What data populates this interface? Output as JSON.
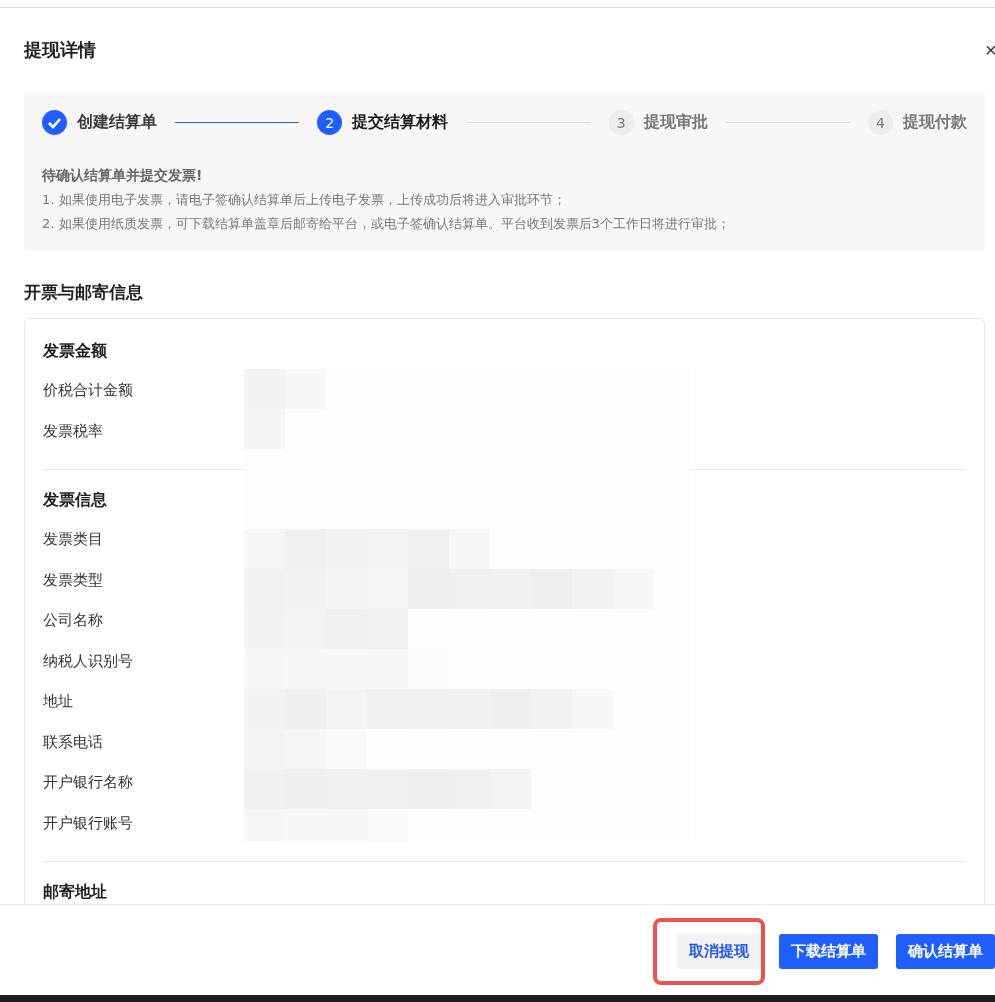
{
  "dialog": {
    "title": "提现详情",
    "close": "×"
  },
  "steps": [
    {
      "label": "创建结算单",
      "completed": true,
      "selected": false
    },
    {
      "index": "2",
      "label": "提交结算材料",
      "completed": false,
      "selected": true
    },
    {
      "index": "3",
      "label": "提现审批",
      "completed": false,
      "selected": false
    },
    {
      "index": "4",
      "label": "提现付款",
      "completed": false,
      "selected": false
    }
  ],
  "notice": {
    "heading": "待确认结算单并提交发票!",
    "lines": [
      "1. 如果使用电子发票，请电子签确认结算单后上传电子发票，上传成功后将进入审批环节；",
      "2. 如果使用纸质发票，可下载结算单盖章后邮寄给平台，或电子签确认结算单。平台收到发票后3个工作日将进行审批；"
    ]
  },
  "section_title": "开票与邮寄信息",
  "groups": [
    {
      "title": "发票金额",
      "fields": [
        "价税合计金额",
        "发票税率"
      ]
    },
    {
      "title": "发票信息",
      "fields": [
        "发票类目",
        "发票类型",
        "公司名称",
        "纳税人识别号",
        "地址",
        "联系电话",
        "开户银行名称",
        "开户银行账号"
      ]
    },
    {
      "title": "邮寄地址"
    }
  ],
  "buttons": [
    {
      "label": "取消提现",
      "kind": "secondary",
      "highlighted": true
    },
    {
      "label": "下载结算单",
      "kind": "primary",
      "highlighted": false
    },
    {
      "label": "确认结算单",
      "kind": "primary",
      "highlighted": false
    }
  ]
}
